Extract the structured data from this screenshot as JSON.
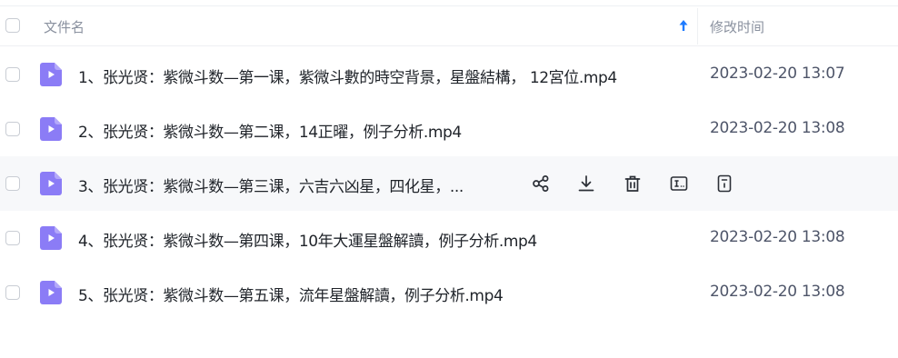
{
  "header": {
    "name_label": "文件名",
    "time_label": "修改时间",
    "sort_icon": "arrow-up-icon"
  },
  "colors": {
    "file_icon": "#8b7cf6",
    "sort_arrow": "#1e7bff",
    "hover_row": "#f7f8fa"
  },
  "files": [
    {
      "name": "1、张光贤：紫微斗数—第一课，紫微斗數的時空背景，星盤結構， 12宮位.mp4",
      "modified": "2023-02-20 13:07",
      "icon": "video-file-icon"
    },
    {
      "name": "2、张光贤：紫微斗数—第二课，14正曜，例子分析.mp4",
      "modified": "2023-02-20 13:08",
      "icon": "video-file-icon"
    },
    {
      "name": "3、张光贤：紫微斗数—第三课，六吉六凶星，四化星，...",
      "modified": "",
      "icon": "video-file-icon"
    },
    {
      "name": "4、张光贤：紫微斗数—第四课，10年大運星盤解讀，例子分析.mp4",
      "modified": "2023-02-20 13:08",
      "icon": "video-file-icon"
    },
    {
      "name": "5、张光贤：紫微斗数—第五课，流年星盤解讀，例子分析.mp4",
      "modified": "2023-02-20 13:08",
      "icon": "video-file-icon"
    }
  ],
  "row_actions": {
    "icons": [
      "share-icon",
      "download-icon",
      "delete-icon",
      "rename-icon",
      "details-icon"
    ]
  }
}
